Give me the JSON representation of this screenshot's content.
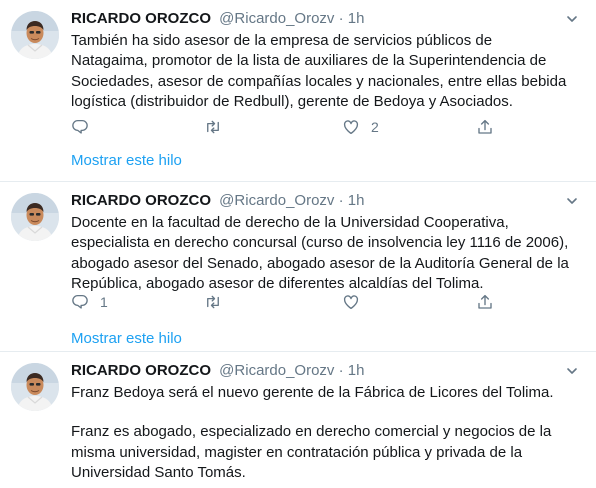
{
  "tweets": [
    {
      "name": "RICARDO OROZCO",
      "handle": "@Ricardo_Orozv",
      "separator": "·",
      "time": "1h",
      "paragraphs": [
        "También ha sido asesor de la empresa de servicios públicos de Natagaima, promotor de la lista de auxiliares de la Superintendencia de Sociedades, asesor de compañías locales y nacionales, entre ellas bebida logística (distribuidor de Redbull), gerente de Bedoya y Asociados."
      ],
      "replies": "",
      "retweets": "",
      "likes": "2",
      "thread_link": "Mostrar este hilo"
    },
    {
      "name": "RICARDO OROZCO",
      "handle": "@Ricardo_Orozv",
      "separator": "·",
      "time": "1h",
      "paragraphs": [
        "Docente en la facultad de derecho de la Universidad Cooperativa, especialista en derecho concursal (curso de insolvencia ley 1116 de 2006), abogado asesor del Senado, abogado asesor de la Auditoría General de la República, abogado asesor de diferentes alcaldías del Tolima."
      ],
      "replies": "1",
      "retweets": "",
      "likes": "",
      "thread_link": "Mostrar este hilo"
    },
    {
      "name": "RICARDO OROZCO",
      "handle": "@Ricardo_Orozv",
      "separator": "·",
      "time": "1h",
      "paragraphs": [
        "Franz Bedoya será el nuevo gerente de la Fábrica de Licores del Tolima.",
        "Franz es abogado, especializado en derecho comercial y negocios de la misma universidad, magister en contratación pública y privada de la Universidad Santo Tomás."
      ]
    }
  ],
  "icons": {
    "reply": "reply-icon",
    "retweet": "retweet-icon",
    "like": "heart-icon",
    "share": "share-icon",
    "more": "chevron-down-icon"
  },
  "colors": {
    "link": "#1da1f2",
    "muted": "#657786",
    "text": "#14171a",
    "divider": "#e6ecf0"
  }
}
